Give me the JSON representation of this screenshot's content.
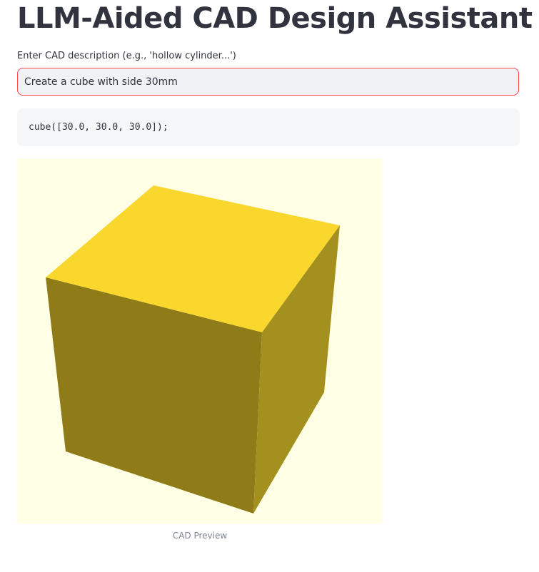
{
  "page": {
    "title": "LLM-Aided CAD Design Assistant"
  },
  "input": {
    "label": "Enter CAD description (e.g., 'hollow cylinder...')",
    "value": "Create a cube with side 30mm",
    "border_color": "#ff4b4b"
  },
  "code": {
    "text": "cube([30.0, 30.0, 30.0]);"
  },
  "preview": {
    "caption": "CAD Preview",
    "background_color": "#ffffe5",
    "cube_colors": {
      "top": "#f9d72c",
      "left": "#8f7c18",
      "right": "#a4901f"
    }
  }
}
